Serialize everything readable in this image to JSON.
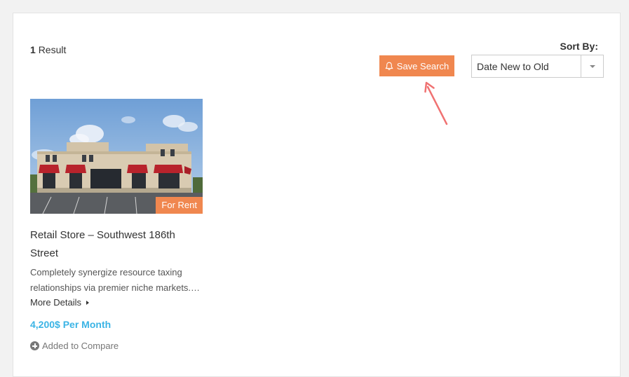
{
  "results": {
    "count": "1",
    "label": "Result"
  },
  "sort": {
    "label": "Sort By:",
    "selected": "Date New to Old"
  },
  "save_search": {
    "label": "Save Search",
    "icon": "bell-icon"
  },
  "listing": {
    "image_alt": "retail-building-photo",
    "status": "For Rent",
    "title": "Retail Store – Southwest 186th Street",
    "description": "Completely synergize resource taxing relationships via premier niche markets.…",
    "more_details": "More Details",
    "price": "4,200$ Per Month",
    "compare": "Added to Compare"
  },
  "colors": {
    "accent": "#f0874f",
    "price": "#3bb4e5",
    "annotation_arrow": "#f07272"
  }
}
